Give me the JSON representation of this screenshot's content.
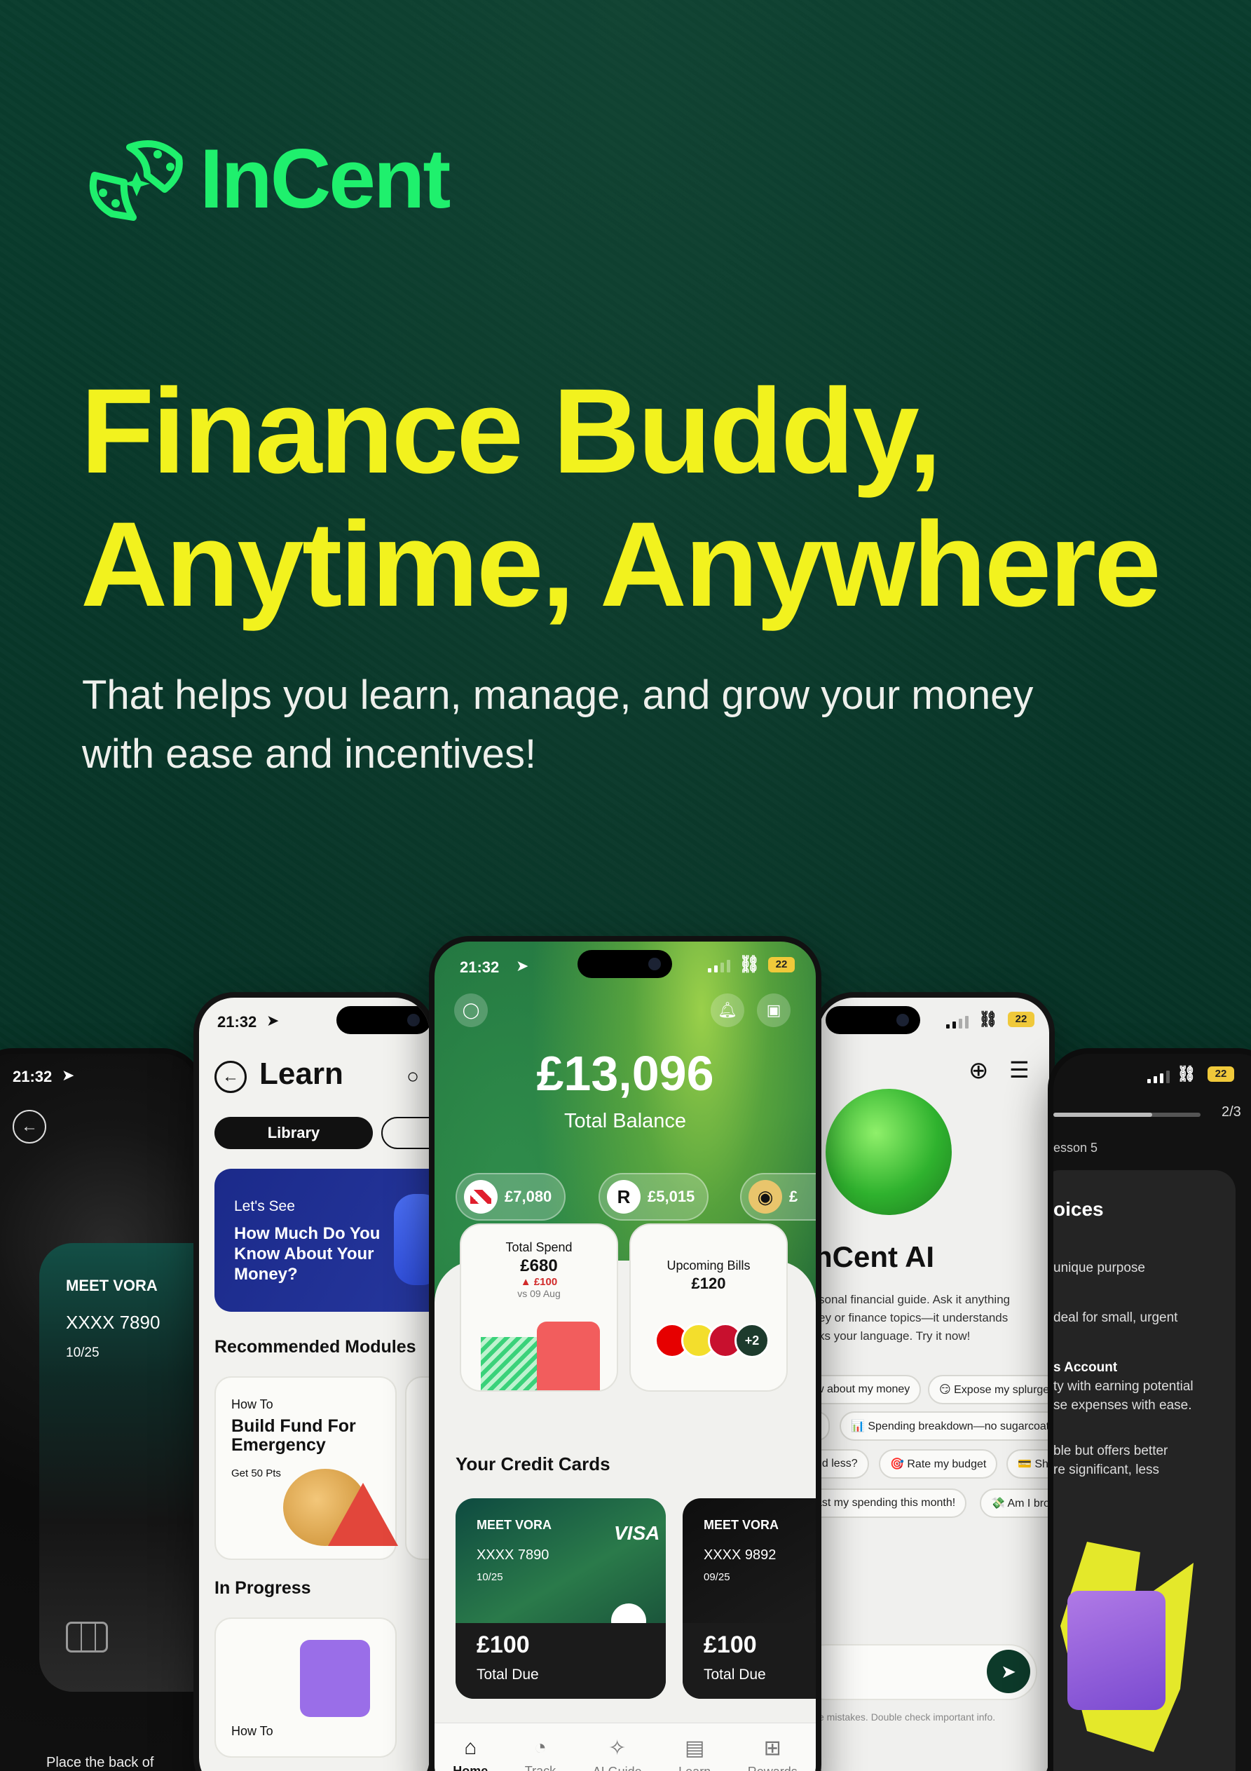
{
  "brand": {
    "name": "InCent",
    "accent": "#1ff06d",
    "headline_color": "#f2f21e",
    "background": "#0b3a2c"
  },
  "hero": {
    "headline_line1": "Finance Buddy,",
    "headline_line2": "Anytime, Anywhere",
    "subhead_line1": "That helps you learn, manage, and grow your money",
    "subhead_line2": "with ease and incentives!"
  },
  "phone_card": {
    "time": "21:32",
    "card_name": "MEET VORA",
    "card_number": "XXXX 7890",
    "card_expiry": "10/25",
    "instruction": "Place the back of"
  },
  "phone_learn": {
    "time": "21:32",
    "title": "Learn",
    "tabs": [
      "Library",
      ""
    ],
    "banner": {
      "kicker": "Let's See",
      "title": "How Much Do You Know About Your Money?"
    },
    "section_recommended": "Recommended Modules",
    "module": {
      "kicker": "How To",
      "title": "Build Fund For Emergency",
      "points": "Get 50 Pts"
    },
    "section_progress": "In Progress",
    "progress_item": {
      "kicker": "How To"
    }
  },
  "phone_home": {
    "time": "21:32",
    "battery": "22",
    "total_balance": "£13,096",
    "total_balance_label": "Total Balance",
    "accounts": [
      {
        "logo": "hsbc-logo",
        "amount": "£7,080"
      },
      {
        "logo": "R",
        "amount": "£5,015"
      },
      {
        "logo": "coin-logo",
        "amount": "£"
      }
    ],
    "total_spend": {
      "label": "Total Spend",
      "amount": "£680",
      "change": "£100",
      "compare": "vs 09 Aug"
    },
    "upcoming_bills": {
      "label": "Upcoming Bills",
      "amount": "£120",
      "more": "+2"
    },
    "credit_cards_title": "Your Credit Cards",
    "credit_cards": [
      {
        "name": "MEET VORA",
        "number": "XXXX 7890",
        "expiry": "10/25",
        "network": "VISA",
        "due": "£100",
        "due_label": "Total Due"
      },
      {
        "name": "MEET VORA",
        "number": "XXXX 9892",
        "expiry": "09/25",
        "due": "£100",
        "due_label": "Total Due"
      }
    ],
    "nav": [
      "Home",
      "Track",
      "AI Guide",
      "Learn",
      "Rewards"
    ]
  },
  "phone_ai": {
    "battery": "22",
    "title": "nCent AI",
    "intro_line1": "sonal financial guide. Ask it anything",
    "intro_line2": "ey or finance topics—it understands",
    "intro_line3": "ks your language. Try it now!",
    "prompts_row1": [
      "w about my money",
      "😏 Expose my splurge"
    ],
    "prompts_row2": [
      "",
      "📊 Spending breakdown—no sugarcoat"
    ],
    "prompts_row3": [
      "nd less?",
      "🎯 Rate my budget",
      "💳 Sho"
    ],
    "prompts_row4": [
      "ast my spending this month!",
      "💸 Am I brok"
    ],
    "disclaimer": "e mistakes. Double check important info."
  },
  "phone_lesson": {
    "battery": "22",
    "progress": "2/3",
    "progress_fraction": 0.67,
    "lesson": "esson 5",
    "heading": "oices",
    "lines": [
      "unique purpose",
      "deal for small, urgent",
      "s Account",
      "ty with earning potential",
      "se expenses with ease.",
      "ble but offers better",
      "re significant, less"
    ]
  }
}
